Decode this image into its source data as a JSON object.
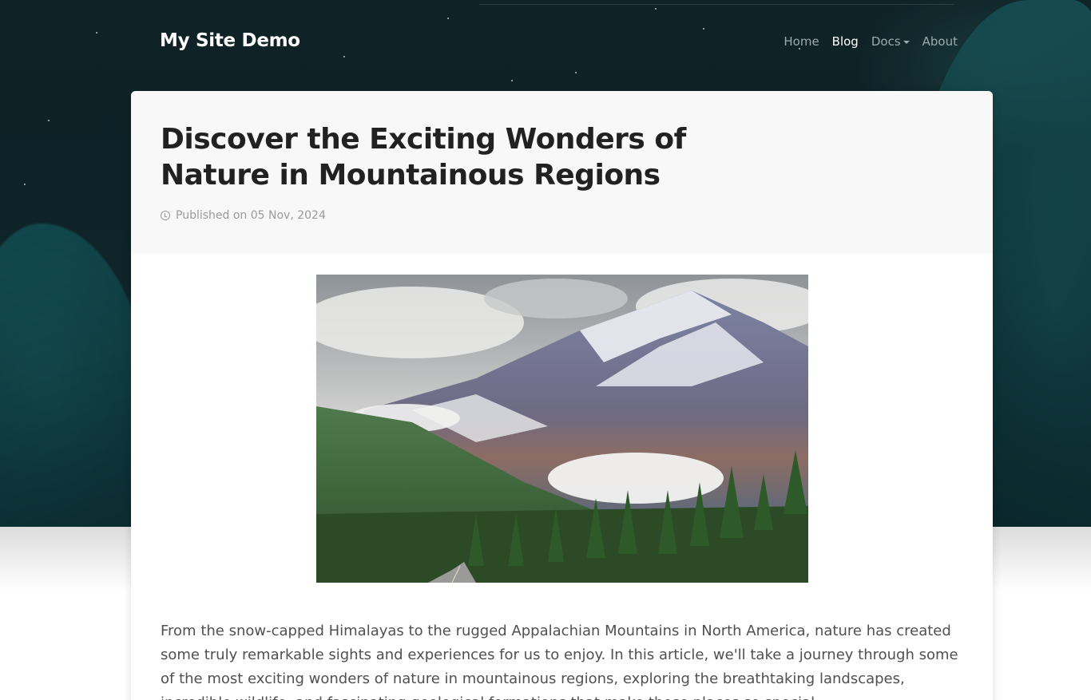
{
  "nav": {
    "brand": "My Site Demo",
    "links": [
      {
        "label": "Home",
        "active": false
      },
      {
        "label": "Blog",
        "active": true
      },
      {
        "label": "Docs",
        "dropdown": true
      },
      {
        "label": "About",
        "active": false
      }
    ]
  },
  "post": {
    "title": "Discover the Exciting Wonders of Nature in Mountainous Regions",
    "meta": "Published on 05 Nov, 2024",
    "paragraph": "From the snow-capped Himalayas to the rugged Appalachian Mountains in North America, nature has created some truly remarkable sights and experiences for us to enjoy. In this article, we'll take a journey through some of the most exciting wonders of nature in mountainous regions, exploring the breathtaking landscapes, incredible wildlife, and fascinating geological formations that make these places so special."
  },
  "colors": {
    "hero_bg": "#0f2226",
    "accent_teal": "#1f6e70",
    "title_text": "#212121",
    "body_text": "#505050"
  }
}
